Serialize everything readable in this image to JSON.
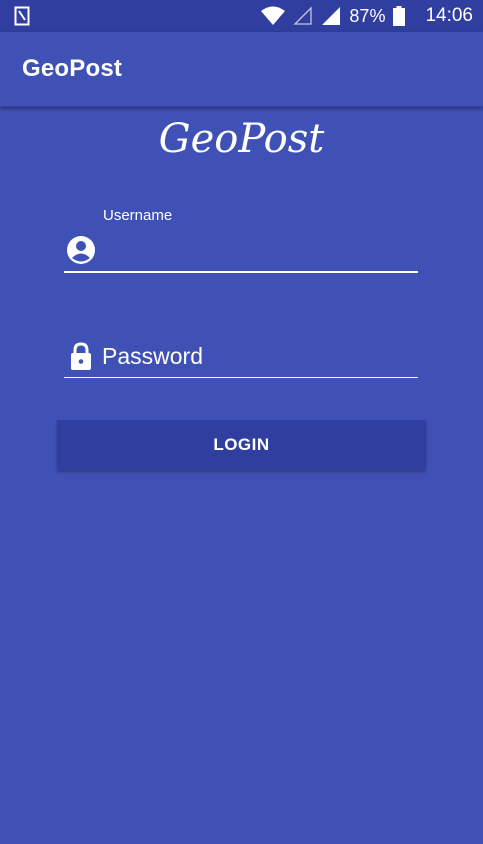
{
  "status_bar": {
    "battery_percent": "87%",
    "time": "14:06",
    "icons": [
      "sim-card-icon",
      "wifi-icon",
      "signal-empty-icon",
      "signal-full-icon",
      "battery-icon"
    ]
  },
  "app_bar": {
    "title": "GeoPost"
  },
  "logo": {
    "text": "GeoPost"
  },
  "form": {
    "username": {
      "label": "Username",
      "value": "",
      "icon": "account-circle-icon"
    },
    "password": {
      "placeholder": "Password",
      "value": "",
      "icon": "lock-icon"
    },
    "login_label": "LOGIN"
  },
  "colors": {
    "primary": "#3f51b5",
    "primary_dark": "#303f9f",
    "text": "#ffffff"
  }
}
